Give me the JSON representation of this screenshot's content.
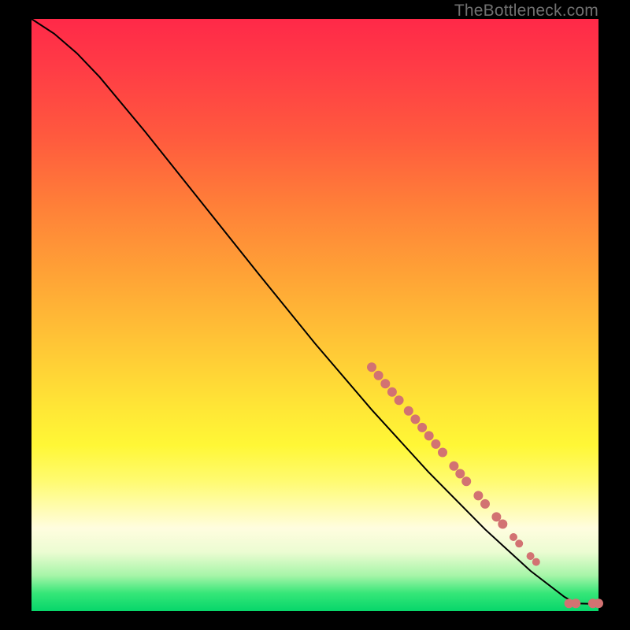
{
  "source_label": "TheBottleneck.com",
  "chart_data": {
    "type": "line",
    "title": "",
    "xlabel": "",
    "ylabel": "",
    "xlim": [
      0,
      100
    ],
    "ylim": [
      0,
      100
    ],
    "curve": [
      {
        "x": 0,
        "y": 100
      },
      {
        "x": 4,
        "y": 97.5
      },
      {
        "x": 8,
        "y": 94.2
      },
      {
        "x": 12,
        "y": 90.2
      },
      {
        "x": 20,
        "y": 81.0
      },
      {
        "x": 30,
        "y": 69.0
      },
      {
        "x": 40,
        "y": 57.0
      },
      {
        "x": 50,
        "y": 45.2
      },
      {
        "x": 60,
        "y": 34.0
      },
      {
        "x": 70,
        "y": 23.5
      },
      {
        "x": 80,
        "y": 13.8
      },
      {
        "x": 88,
        "y": 6.8
      },
      {
        "x": 94,
        "y": 2.4
      },
      {
        "x": 96,
        "y": 1.3
      },
      {
        "x": 100,
        "y": 1.2
      }
    ],
    "points": [
      {
        "x": 60.0,
        "y": 41.2,
        "r": 6
      },
      {
        "x": 61.2,
        "y": 39.8,
        "r": 6
      },
      {
        "x": 62.4,
        "y": 38.4,
        "r": 6
      },
      {
        "x": 63.6,
        "y": 37.0,
        "r": 6
      },
      {
        "x": 64.8,
        "y": 35.6,
        "r": 6
      },
      {
        "x": 66.5,
        "y": 33.8,
        "r": 6
      },
      {
        "x": 67.7,
        "y": 32.4,
        "r": 6
      },
      {
        "x": 68.9,
        "y": 31.0,
        "r": 6
      },
      {
        "x": 70.1,
        "y": 29.6,
        "r": 6
      },
      {
        "x": 71.3,
        "y": 28.2,
        "r": 6
      },
      {
        "x": 72.5,
        "y": 26.8,
        "r": 6
      },
      {
        "x": 74.5,
        "y": 24.5,
        "r": 6
      },
      {
        "x": 75.6,
        "y": 23.2,
        "r": 6
      },
      {
        "x": 76.7,
        "y": 21.9,
        "r": 6
      },
      {
        "x": 78.8,
        "y": 19.5,
        "r": 6
      },
      {
        "x": 80.0,
        "y": 18.1,
        "r": 6
      },
      {
        "x": 82.0,
        "y": 15.9,
        "r": 6
      },
      {
        "x": 83.1,
        "y": 14.7,
        "r": 6
      },
      {
        "x": 85.0,
        "y": 12.5,
        "r": 5
      },
      {
        "x": 86.0,
        "y": 11.4,
        "r": 5
      },
      {
        "x": 88.0,
        "y": 9.3,
        "r": 5
      },
      {
        "x": 89.0,
        "y": 8.3,
        "r": 5
      },
      {
        "x": 94.8,
        "y": 1.3,
        "r": 6
      },
      {
        "x": 96.0,
        "y": 1.3,
        "r": 6
      },
      {
        "x": 99.0,
        "y": 1.3,
        "r": 6
      },
      {
        "x": 100.0,
        "y": 1.3,
        "r": 6
      }
    ],
    "point_color": "#d27272"
  }
}
